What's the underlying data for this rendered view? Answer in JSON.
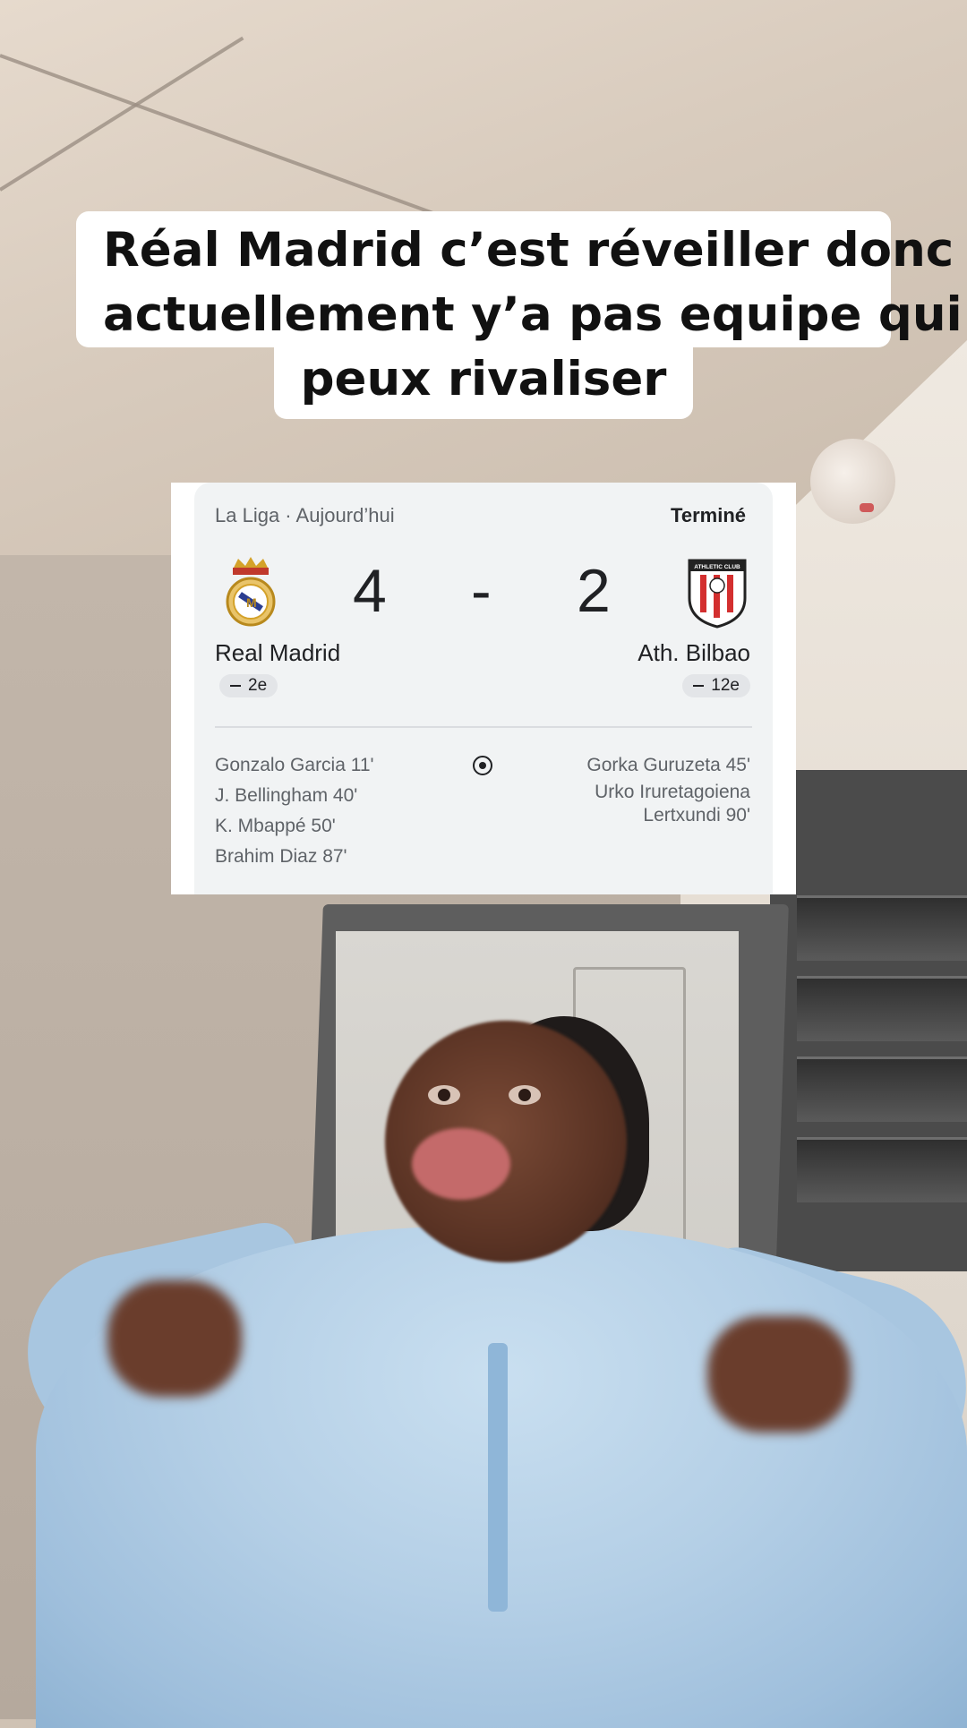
{
  "caption": {
    "line1": "Réal Madrid c’est réveiller donc",
    "line2": "actuellement y’a pas equipe qui",
    "line3": "peux rivaliser"
  },
  "match": {
    "competition": "La Liga · Aujourd’hui",
    "status": "Terminé",
    "home": {
      "name": "Real Madrid",
      "score": "4",
      "rank": "2e",
      "crest_icon": "real-madrid-crest-icon",
      "scorers": [
        "Gonzalo Garcia 11'",
        "J. Bellingham 40'",
        "K. Mbappé 50'",
        "Brahim Diaz 87'"
      ]
    },
    "separator": "-",
    "away": {
      "name": "Ath. Bilbao",
      "score": "2",
      "rank": "12e",
      "crest_icon": "athletic-club-crest-icon",
      "crest_text": "ATHLETIC CLUB",
      "scorers": [
        "Gorka Guruzeta 45'",
        "Urko Iruretagoiena",
        "Lertxundi 90'"
      ]
    },
    "goal_icon": "soccer-ball-icon"
  }
}
